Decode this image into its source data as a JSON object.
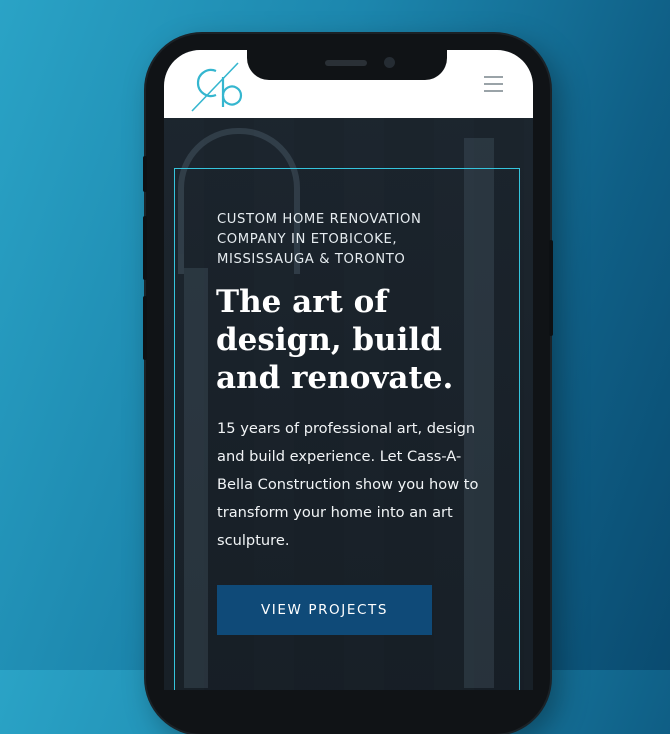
{
  "header": {
    "logo_text": "cb",
    "menu_icon": "hamburger-menu-icon"
  },
  "hero": {
    "eyebrow": "CUSTOM HOME RENOVATION COMPANY IN ETOBICOKE, MISSISSAUGA & TORONTO",
    "headline": "The art of design, build and renovate.",
    "description": "15 years of professional art, design and build experience. Let Cass-A-Bella Construction show you how to transform your home into an art sculpture.",
    "cta_label": "VIEW PROJECTS"
  },
  "colors": {
    "accent": "#35c4dc",
    "button": "#0f4a78",
    "background_gradient_start": "#2aa3c6",
    "background_gradient_end": "#0a4b70"
  }
}
